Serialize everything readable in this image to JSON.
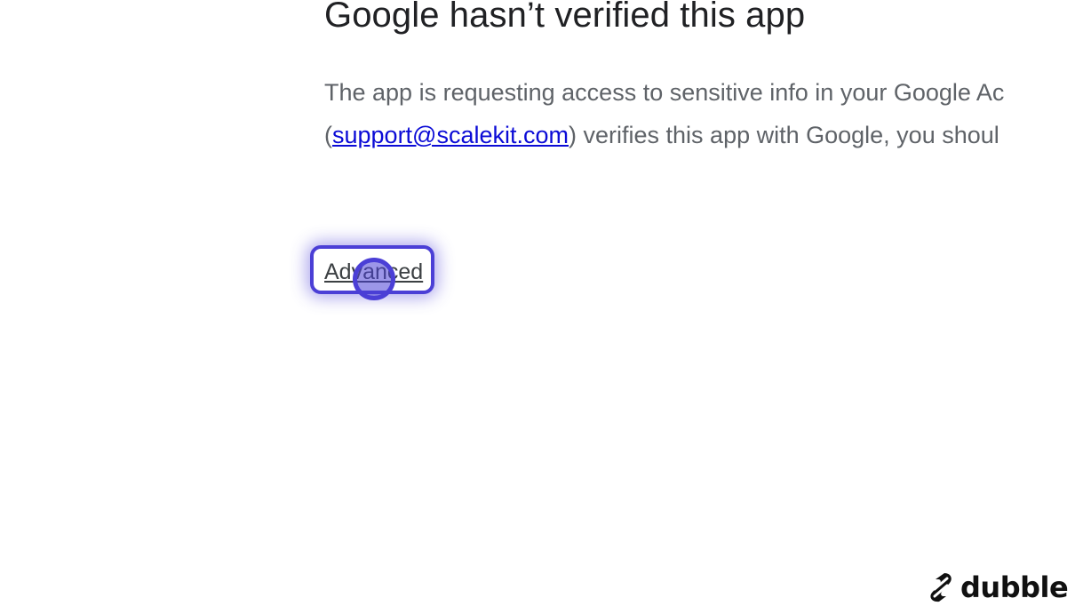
{
  "heading": "Google hasn’t verified this app",
  "body": {
    "line1": "The app is requesting access to sensitive info in your Google Ac",
    "line2_prefix": "(",
    "email": "support@scalekit.com",
    "line2_suffix": ") verifies this app with Google, you shoul"
  },
  "advanced_link": "Advanced",
  "brand": {
    "name": "dubble",
    "icon": "dubble-logo-icon"
  },
  "colors": {
    "highlight": "#4b3fd6",
    "link": "#0b0bd6",
    "heading": "#202124",
    "body": "#5f6368"
  }
}
